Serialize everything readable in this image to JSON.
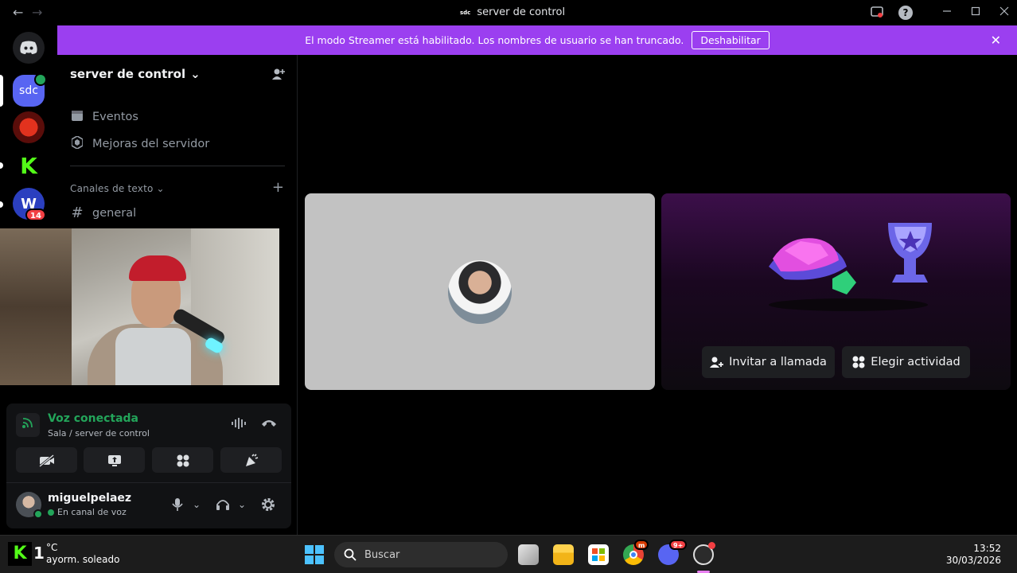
{
  "window": {
    "title": "server de control",
    "title_mini": "sdc",
    "back_icon": "←",
    "forward_icon": "→"
  },
  "banner": {
    "message": "El modo Streamer está habilitado. Los nombres de usuario se han truncado.",
    "button_label": "Deshabilitar",
    "color": "#9b3ff0"
  },
  "rail": {
    "active_server_initials": "sdc",
    "mention_badge": "14"
  },
  "sidebar": {
    "server_name": "server de control",
    "items": [
      {
        "label": "Eventos",
        "icon": "calendar-icon"
      },
      {
        "label": "Mejoras del servidor",
        "icon": "boost-icon"
      }
    ],
    "category": "Canales de texto",
    "channels": [
      {
        "label": "general"
      }
    ]
  },
  "voice": {
    "status": "Voz conectada",
    "location": "Sala / server de control",
    "status_color": "#23a55a"
  },
  "user": {
    "name": "miguelpelaez",
    "status": "En canal de voz"
  },
  "main": {
    "invite_label": "Invitar a llamada",
    "activity_label": "Elegir actividad"
  },
  "taskbar": {
    "weather_line1": "°C",
    "weather_line2": "ayorm. soleado",
    "weather_number": "1",
    "search_placeholder": "Buscar",
    "time": "13:52",
    "date": "30/03/2026",
    "chrome_badge": "m",
    "discord_badge": "9+"
  }
}
